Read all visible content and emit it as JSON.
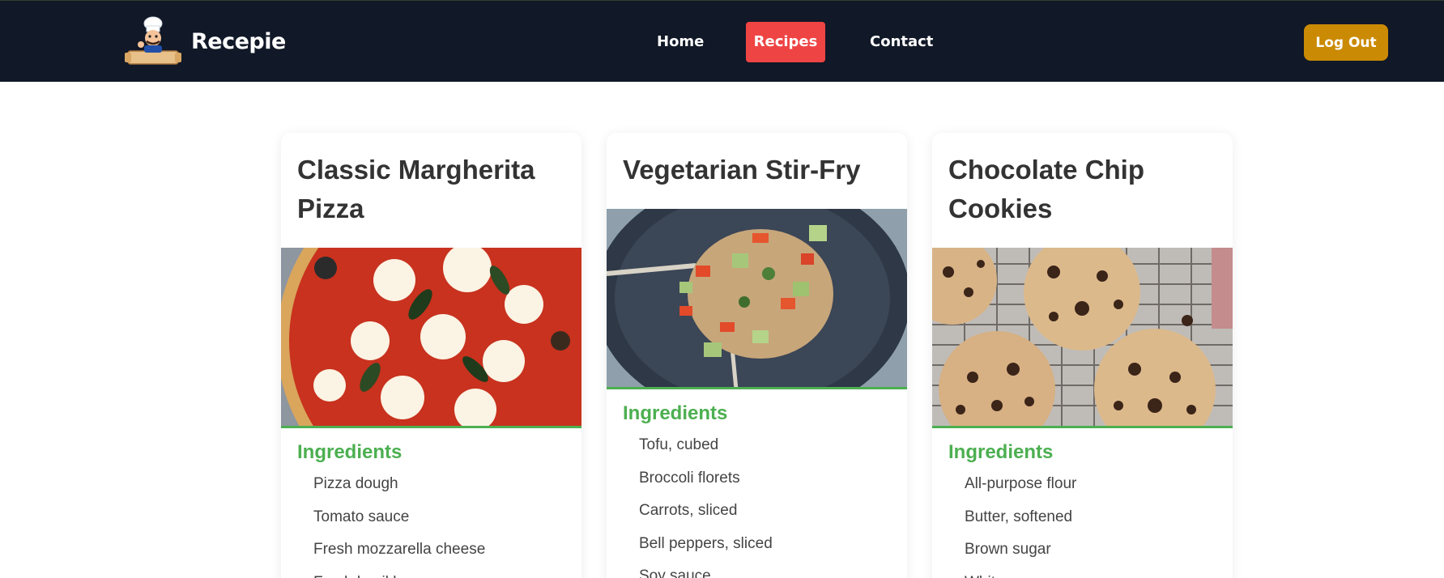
{
  "app": {
    "brand_name": "Recepie",
    "logo": "chef-logo"
  },
  "nav": {
    "home_label": "Home",
    "recipes_label": "Recipes",
    "contact_label": "Contact",
    "active": "Recipes",
    "logout_label": "Log Out"
  },
  "colors": {
    "nav_bg": "#111827",
    "active_tab": "#ef4444",
    "logout_button": "#ca8a04",
    "ingredients_heading": "#4caf50"
  },
  "recipes": [
    {
      "title": "Classic Margherita Pizza",
      "image": "margherita-pizza-photo",
      "ingredients_heading": "Ingredients",
      "ingredients": [
        "Pizza dough",
        "Tomato sauce",
        "Fresh mozzarella cheese",
        "Fresh basil leaves"
      ]
    },
    {
      "title": "Vegetarian Stir-Fry",
      "image": "vegetable-stir-fry-photo",
      "ingredients_heading": "Ingredients",
      "ingredients": [
        "Tofu, cubed",
        "Broccoli florets",
        "Carrots, sliced",
        "Bell peppers, sliced",
        "Soy sauce"
      ]
    },
    {
      "title": "Chocolate Chip Cookies",
      "image": "chocolate-chip-cookies-photo",
      "ingredients_heading": "Ingredients",
      "ingredients": [
        "All-purpose flour",
        "Butter, softened",
        "Brown sugar",
        "White sugar"
      ]
    }
  ]
}
